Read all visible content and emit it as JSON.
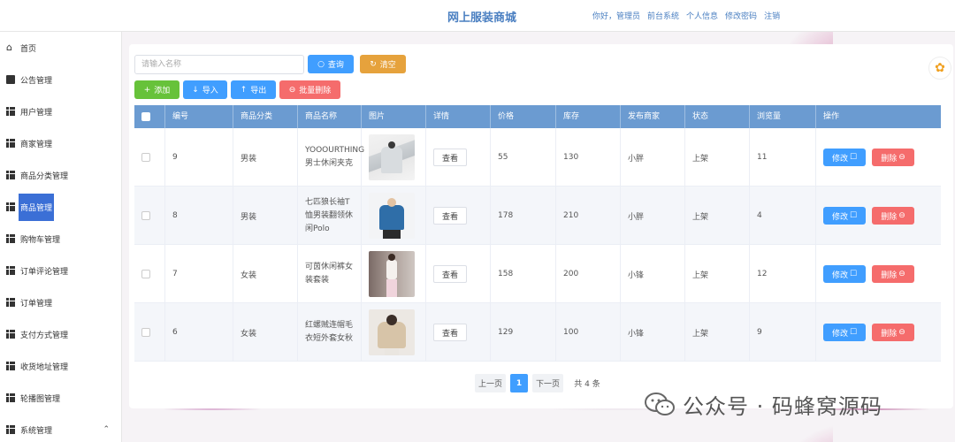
{
  "header": {
    "title": "网上服装商城",
    "links": [
      "你好，管理员",
      "前台系统",
      "个人信息",
      "修改密码",
      "注销"
    ]
  },
  "sidebar": {
    "items": [
      {
        "label": "首页",
        "icon": "home-icon"
      },
      {
        "label": "公告管理",
        "icon": "chat-icon"
      },
      {
        "label": "用户管理",
        "icon": "grid-icon"
      },
      {
        "label": "商家管理",
        "icon": "grid-icon"
      },
      {
        "label": "商品分类管理",
        "icon": "grid-icon"
      },
      {
        "label": "商品管理",
        "icon": "grid-icon",
        "active": true
      },
      {
        "label": "购物车管理",
        "icon": "grid-icon"
      },
      {
        "label": "订单评论管理",
        "icon": "grid-icon"
      },
      {
        "label": "订单管理",
        "icon": "grid-icon"
      },
      {
        "label": "支付方式管理",
        "icon": "grid-icon"
      },
      {
        "label": "收货地址管理",
        "icon": "grid-icon"
      },
      {
        "label": "轮播图管理",
        "icon": "grid-icon"
      },
      {
        "label": "系统管理",
        "icon": "grid-icon"
      }
    ],
    "active_color": "#3b6fd6"
  },
  "search": {
    "placeholder": "请输入名称",
    "query_label": "查询",
    "clear_label": "清空"
  },
  "toolbar": {
    "add_label": "添加",
    "import_label": "导入",
    "export_label": "导出",
    "batch_delete_label": "批量删除"
  },
  "table": {
    "headers": [
      "编号",
      "商品分类",
      "商品名称",
      "图片",
      "详情",
      "价格",
      "库存",
      "发布商家",
      "状态",
      "浏览量",
      "操作"
    ],
    "rows": [
      {
        "id": "9",
        "category": "男装",
        "name": "YOOOURTHING男士休闲夹克",
        "detail": "查看",
        "price": "55",
        "stock": "130",
        "merchant": "小胖",
        "status": "上架",
        "views": "11"
      },
      {
        "id": "8",
        "category": "男装",
        "name": "七匹狼长袖T恤男装翻领休闲Polo",
        "detail": "查看",
        "price": "178",
        "stock": "210",
        "merchant": "小胖",
        "status": "上架",
        "views": "4"
      },
      {
        "id": "7",
        "category": "女装",
        "name": "可茵休闲裤女装套装",
        "detail": "查看",
        "price": "158",
        "stock": "200",
        "merchant": "小锋",
        "status": "上架",
        "views": "12"
      },
      {
        "id": "6",
        "category": "女装",
        "name": "红螺贼连帽毛衣短外套女秋",
        "detail": "查看",
        "price": "129",
        "stock": "100",
        "merchant": "小锋",
        "status": "上架",
        "views": "9"
      }
    ],
    "edit_label": "修改",
    "delete_label": "删除",
    "header_color": "#6b9bd1"
  },
  "pagination": {
    "prev": "上一页",
    "current": "1",
    "next": "下一页",
    "total": "共 4 条"
  },
  "watermark": {
    "text": "公众号 · 码蜂窝源码"
  },
  "colors": {
    "primary": "#409eff",
    "success": "#67c23a",
    "warning": "#e6a23c",
    "danger": "#f56c6c"
  }
}
